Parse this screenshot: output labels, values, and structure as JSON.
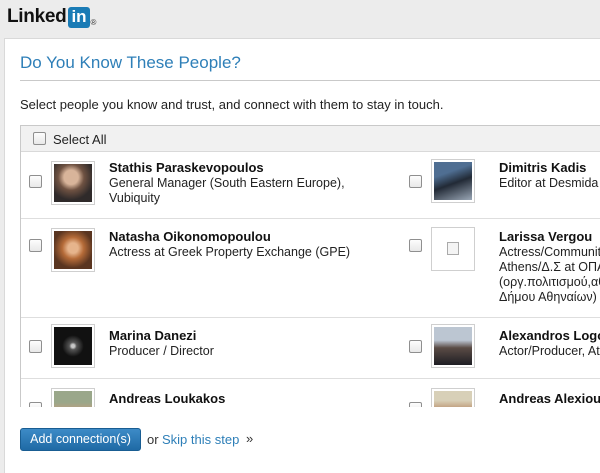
{
  "brand": {
    "name": "Linked",
    "box": "in",
    "reg": "®"
  },
  "dialog": {
    "title": "Do You Know These People?",
    "intro": "Select people you know and trust, and connect with them to stay in touch.",
    "select_all": "Select All"
  },
  "people": [
    {
      "left": {
        "name": "Stathis Paraskevopoulos",
        "title_lines": [
          "General Manager (South Eastern Europe),",
          "Vubiquity"
        ],
        "photo": "photo-man-dark-sweater"
      },
      "right": {
        "name": "Dimitris Kadis",
        "title_lines": [
          "Editor at Desmida"
        ],
        "photo": "photo-man-car"
      }
    },
    {
      "left": {
        "name": "Natasha Oikonomopoulou",
        "title_lines": [
          "Actress at Greek Property Exchange (GPE)"
        ],
        "photo": "photo-woman-blonde"
      },
      "right": {
        "name": "Larissa Vergou",
        "title_lines": [
          "Actress/Community",
          "Athens/Δ.Σ at ΟΠΑ",
          "(οργ.πολιτισμού,αθ",
          "Δήμου Αθηναίων)"
        ],
        "photo": "broken-image-icon"
      }
    },
    {
      "left": {
        "name": "Marina Danezi",
        "title_lines": [
          "Producer / Director"
        ],
        "photo": "photo-dark-figure"
      },
      "right": {
        "name": "Alexandros Logot",
        "title_lines": [
          "Actor/Producer, Ath"
        ],
        "photo": "photo-man-street"
      }
    },
    {
      "left": {
        "name": "Andreas Loukakos",
        "title_lines": [],
        "photo": "photo-man-outdoor"
      },
      "right": {
        "name": "Andreas Alexiou",
        "title_lines": [],
        "photo": "photo-man-portrait"
      }
    }
  ],
  "footer": {
    "add_button": "Add connection(s)",
    "or": "or",
    "skip": "Skip this step",
    "raquo": "»"
  },
  "colors": {
    "accent": "#2e7fb8",
    "button": "#1f6aa5",
    "brand": "#1a7bb5"
  }
}
